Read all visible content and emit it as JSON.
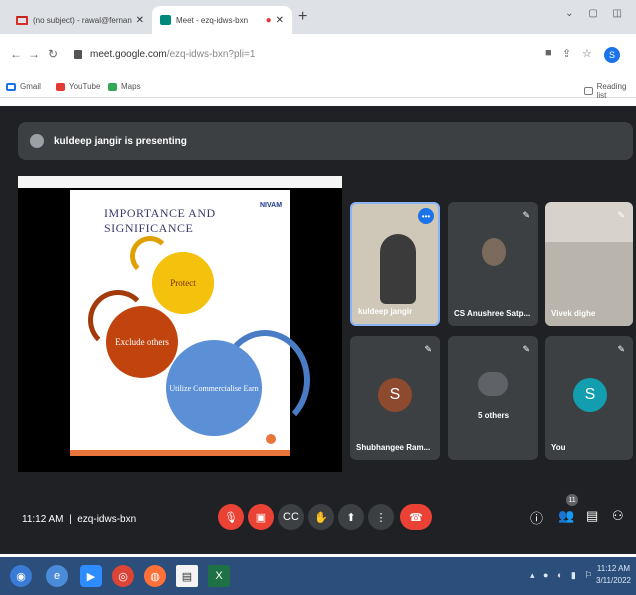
{
  "browser": {
    "tabs": [
      {
        "label": "(no subject) - rawal@fernandez",
        "icon": "gmail-icon"
      },
      {
        "label": "Meet - ezq-idws-bxn",
        "icon": "meet-icon"
      }
    ],
    "url_host": "meet.google.com",
    "url_path": "/ezq-idws-bxn?pli=1",
    "profile_initial": "S",
    "bookmarks": [
      "Gmail",
      "YouTube",
      "Maps"
    ],
    "reading_list": "Reading list"
  },
  "meet": {
    "presenting_banner": "kuldeep jangir is presenting",
    "slide": {
      "title": "IMPORTANCE AND SIGNIFICANCE",
      "logo": "NIVAM",
      "gears": [
        "Protect",
        "Exclude others",
        "Utilize Commercialise Earn"
      ]
    },
    "participants": [
      {
        "name": "kuldeep jangir"
      },
      {
        "name": "CS Anushree Satp..."
      },
      {
        "name": "Vivek dighe"
      },
      {
        "name": "Shubhangee Ram...",
        "initial": "S"
      },
      {
        "name": "5 others"
      },
      {
        "name": "You",
        "initial": "S"
      }
    ],
    "time": "11:12 AM",
    "meeting_code": "ezq-idws-bxn",
    "participant_count": "11",
    "colors": {
      "accent": "#1a73e8",
      "danger": "#ea4335",
      "bg": "#202124"
    }
  },
  "taskbar": {
    "time": "11:12 AM",
    "date": "3/11/2022"
  }
}
